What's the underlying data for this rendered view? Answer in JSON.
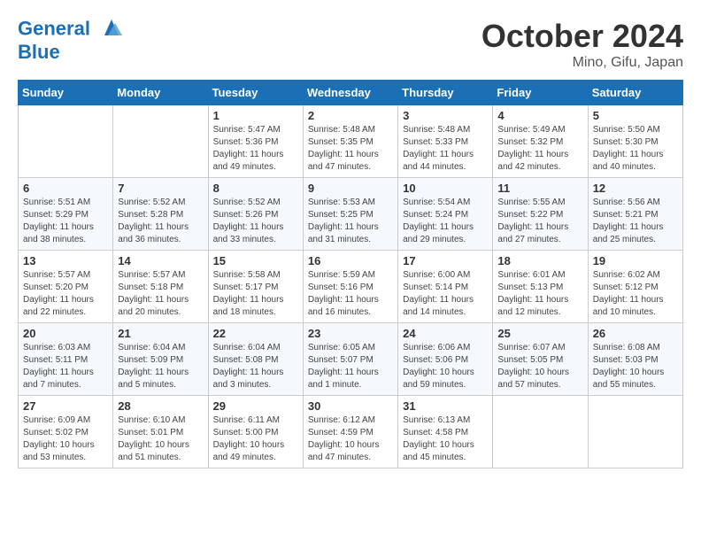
{
  "header": {
    "logo_line1": "General",
    "logo_line2": "Blue",
    "month": "October 2024",
    "location": "Mino, Gifu, Japan"
  },
  "columns": [
    "Sunday",
    "Monday",
    "Tuesday",
    "Wednesday",
    "Thursday",
    "Friday",
    "Saturday"
  ],
  "weeks": [
    [
      {
        "day": "",
        "sunrise": "",
        "sunset": "",
        "daylight": ""
      },
      {
        "day": "",
        "sunrise": "",
        "sunset": "",
        "daylight": ""
      },
      {
        "day": "1",
        "sunrise": "Sunrise: 5:47 AM",
        "sunset": "Sunset: 5:36 PM",
        "daylight": "Daylight: 11 hours and 49 minutes."
      },
      {
        "day": "2",
        "sunrise": "Sunrise: 5:48 AM",
        "sunset": "Sunset: 5:35 PM",
        "daylight": "Daylight: 11 hours and 47 minutes."
      },
      {
        "day": "3",
        "sunrise": "Sunrise: 5:48 AM",
        "sunset": "Sunset: 5:33 PM",
        "daylight": "Daylight: 11 hours and 44 minutes."
      },
      {
        "day": "4",
        "sunrise": "Sunrise: 5:49 AM",
        "sunset": "Sunset: 5:32 PM",
        "daylight": "Daylight: 11 hours and 42 minutes."
      },
      {
        "day": "5",
        "sunrise": "Sunrise: 5:50 AM",
        "sunset": "Sunset: 5:30 PM",
        "daylight": "Daylight: 11 hours and 40 minutes."
      }
    ],
    [
      {
        "day": "6",
        "sunrise": "Sunrise: 5:51 AM",
        "sunset": "Sunset: 5:29 PM",
        "daylight": "Daylight: 11 hours and 38 minutes."
      },
      {
        "day": "7",
        "sunrise": "Sunrise: 5:52 AM",
        "sunset": "Sunset: 5:28 PM",
        "daylight": "Daylight: 11 hours and 36 minutes."
      },
      {
        "day": "8",
        "sunrise": "Sunrise: 5:52 AM",
        "sunset": "Sunset: 5:26 PM",
        "daylight": "Daylight: 11 hours and 33 minutes."
      },
      {
        "day": "9",
        "sunrise": "Sunrise: 5:53 AM",
        "sunset": "Sunset: 5:25 PM",
        "daylight": "Daylight: 11 hours and 31 minutes."
      },
      {
        "day": "10",
        "sunrise": "Sunrise: 5:54 AM",
        "sunset": "Sunset: 5:24 PM",
        "daylight": "Daylight: 11 hours and 29 minutes."
      },
      {
        "day": "11",
        "sunrise": "Sunrise: 5:55 AM",
        "sunset": "Sunset: 5:22 PM",
        "daylight": "Daylight: 11 hours and 27 minutes."
      },
      {
        "day": "12",
        "sunrise": "Sunrise: 5:56 AM",
        "sunset": "Sunset: 5:21 PM",
        "daylight": "Daylight: 11 hours and 25 minutes."
      }
    ],
    [
      {
        "day": "13",
        "sunrise": "Sunrise: 5:57 AM",
        "sunset": "Sunset: 5:20 PM",
        "daylight": "Daylight: 11 hours and 22 minutes."
      },
      {
        "day": "14",
        "sunrise": "Sunrise: 5:57 AM",
        "sunset": "Sunset: 5:18 PM",
        "daylight": "Daylight: 11 hours and 20 minutes."
      },
      {
        "day": "15",
        "sunrise": "Sunrise: 5:58 AM",
        "sunset": "Sunset: 5:17 PM",
        "daylight": "Daylight: 11 hours and 18 minutes."
      },
      {
        "day": "16",
        "sunrise": "Sunrise: 5:59 AM",
        "sunset": "Sunset: 5:16 PM",
        "daylight": "Daylight: 11 hours and 16 minutes."
      },
      {
        "day": "17",
        "sunrise": "Sunrise: 6:00 AM",
        "sunset": "Sunset: 5:14 PM",
        "daylight": "Daylight: 11 hours and 14 minutes."
      },
      {
        "day": "18",
        "sunrise": "Sunrise: 6:01 AM",
        "sunset": "Sunset: 5:13 PM",
        "daylight": "Daylight: 11 hours and 12 minutes."
      },
      {
        "day": "19",
        "sunrise": "Sunrise: 6:02 AM",
        "sunset": "Sunset: 5:12 PM",
        "daylight": "Daylight: 11 hours and 10 minutes."
      }
    ],
    [
      {
        "day": "20",
        "sunrise": "Sunrise: 6:03 AM",
        "sunset": "Sunset: 5:11 PM",
        "daylight": "Daylight: 11 hours and 7 minutes."
      },
      {
        "day": "21",
        "sunrise": "Sunrise: 6:04 AM",
        "sunset": "Sunset: 5:09 PM",
        "daylight": "Daylight: 11 hours and 5 minutes."
      },
      {
        "day": "22",
        "sunrise": "Sunrise: 6:04 AM",
        "sunset": "Sunset: 5:08 PM",
        "daylight": "Daylight: 11 hours and 3 minutes."
      },
      {
        "day": "23",
        "sunrise": "Sunrise: 6:05 AM",
        "sunset": "Sunset: 5:07 PM",
        "daylight": "Daylight: 11 hours and 1 minute."
      },
      {
        "day": "24",
        "sunrise": "Sunrise: 6:06 AM",
        "sunset": "Sunset: 5:06 PM",
        "daylight": "Daylight: 10 hours and 59 minutes."
      },
      {
        "day": "25",
        "sunrise": "Sunrise: 6:07 AM",
        "sunset": "Sunset: 5:05 PM",
        "daylight": "Daylight: 10 hours and 57 minutes."
      },
      {
        "day": "26",
        "sunrise": "Sunrise: 6:08 AM",
        "sunset": "Sunset: 5:03 PM",
        "daylight": "Daylight: 10 hours and 55 minutes."
      }
    ],
    [
      {
        "day": "27",
        "sunrise": "Sunrise: 6:09 AM",
        "sunset": "Sunset: 5:02 PM",
        "daylight": "Daylight: 10 hours and 53 minutes."
      },
      {
        "day": "28",
        "sunrise": "Sunrise: 6:10 AM",
        "sunset": "Sunset: 5:01 PM",
        "daylight": "Daylight: 10 hours and 51 minutes."
      },
      {
        "day": "29",
        "sunrise": "Sunrise: 6:11 AM",
        "sunset": "Sunset: 5:00 PM",
        "daylight": "Daylight: 10 hours and 49 minutes."
      },
      {
        "day": "30",
        "sunrise": "Sunrise: 6:12 AM",
        "sunset": "Sunset: 4:59 PM",
        "daylight": "Daylight: 10 hours and 47 minutes."
      },
      {
        "day": "31",
        "sunrise": "Sunrise: 6:13 AM",
        "sunset": "Sunset: 4:58 PM",
        "daylight": "Daylight: 10 hours and 45 minutes."
      },
      {
        "day": "",
        "sunrise": "",
        "sunset": "",
        "daylight": ""
      },
      {
        "day": "",
        "sunrise": "",
        "sunset": "",
        "daylight": ""
      }
    ]
  ]
}
